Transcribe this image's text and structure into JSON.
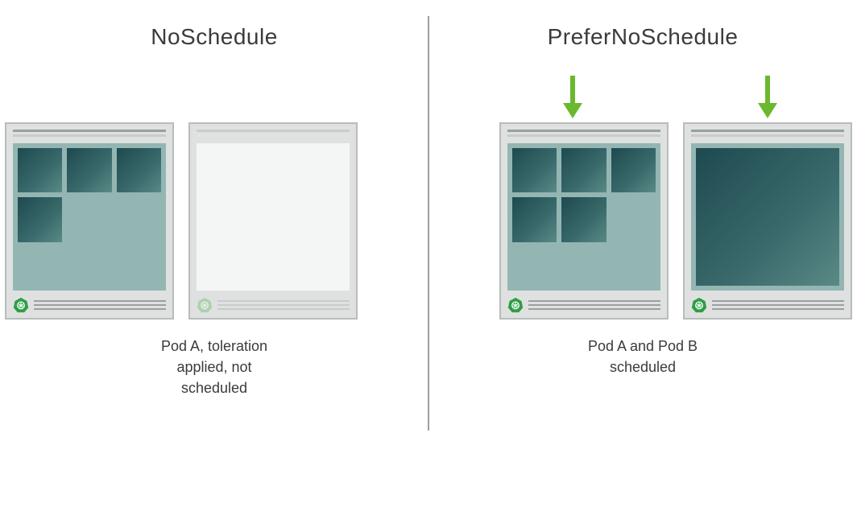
{
  "left": {
    "heading": "NoSchedule",
    "footer": "Pod A, toleration\napplied, not\nscheduled"
  },
  "right": {
    "heading": "PreferNoSchedule",
    "footer": "Pod A and Pod B\nscheduled"
  },
  "colors": {
    "accent_green": "#6ab82e",
    "k8s_green": "#2f9e44",
    "pod_dark": "#1e4a4f"
  },
  "icons": {
    "kubernetes": "kubernetes-icon",
    "arrow_down": "arrow-down-icon"
  },
  "nodes": {
    "left1_pods": 4,
    "left2_pods": 0,
    "right1_pods": 5,
    "right2_big_pod": true
  }
}
